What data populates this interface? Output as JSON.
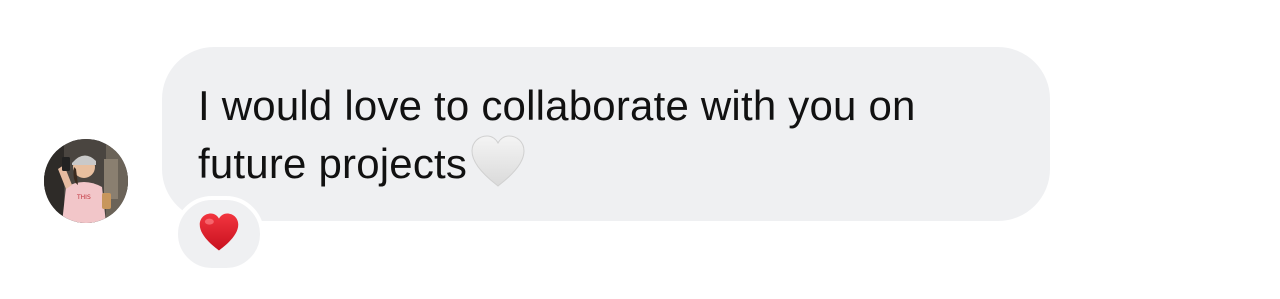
{
  "message": {
    "text": "I would love to collaborate with you on future projects",
    "line1": "I would love to collaborate with you on",
    "line2": "future projects",
    "inline_emoji": "white-heart-icon",
    "bubble_color": "#eff0f2",
    "text_color": "#111111"
  },
  "reaction": {
    "emoji": "red-heart-icon",
    "color": "#e0172b"
  },
  "sender": {
    "avatar": "avatar-photo"
  }
}
